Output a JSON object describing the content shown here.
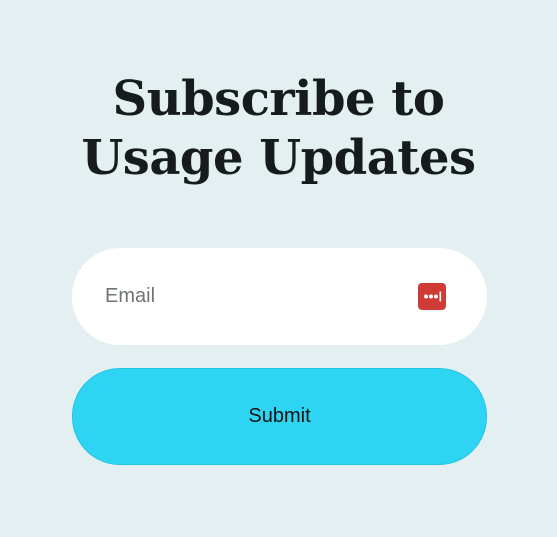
{
  "form": {
    "title_line1": "Subscribe to",
    "title_line2": "Usage Updates",
    "email": {
      "placeholder": "Email",
      "value": ""
    },
    "password_manager_icon": "password-manager-icon",
    "submit_label": "Submit"
  },
  "colors": {
    "background": "#e3eff0",
    "title": "#161b1c",
    "input_background": "#ffffff",
    "placeholder": "#6f7576",
    "icon_red": "#d13b36",
    "submit_background": "#2ed5f3"
  }
}
